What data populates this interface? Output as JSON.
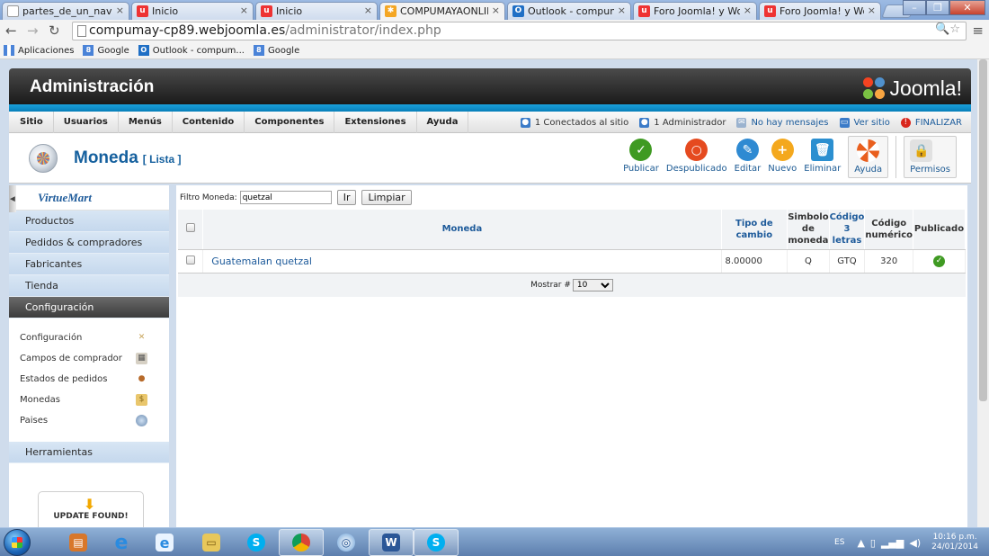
{
  "browser": {
    "tabs": [
      {
        "title": "partes_de_un_navegad",
        "icon": "doc"
      },
      {
        "title": "Inicio",
        "icon": "u"
      },
      {
        "title": "Inicio",
        "icon": "u"
      },
      {
        "title": "COMPUMAYAONLINE",
        "icon": "joomla"
      },
      {
        "title": "Outlook - compumaya",
        "icon": "outlook"
      },
      {
        "title": "Foro Joomla! y WordP",
        "icon": "u"
      },
      {
        "title": "Foro Joomla! y WordP",
        "icon": "u"
      }
    ],
    "url_host": "compumay-cp89.webjoomla.es",
    "url_path": "/administrator/index.php",
    "bookmarks": [
      {
        "label": "Aplicaciones",
        "icon": "apps"
      },
      {
        "label": "Google",
        "icon": "g"
      },
      {
        "label": "Outlook - compum...",
        "icon": "o"
      },
      {
        "label": "Google",
        "icon": "g"
      }
    ]
  },
  "joomla": {
    "admin_title": "Administración",
    "logo_text": "Joomla!",
    "menu": [
      "Sitio",
      "Usuarios",
      "Menús",
      "Contenido",
      "Componentes",
      "Extensiones",
      "Ayuda"
    ],
    "status": {
      "connected": "1 Conectados al sitio",
      "admins": "1 Administrador",
      "messages": "No hay mensajes",
      "view_site": "Ver sitio",
      "logout": "FINALIZAR"
    },
    "page_title": "Moneda",
    "page_subtitle": "[ Lista ]",
    "toolbar": [
      "Publicar",
      "Despublicado",
      "Editar",
      "Nuevo",
      "Eliminar",
      "Ayuda",
      "Permisos"
    ]
  },
  "sidebar": {
    "logo": "VirtueMart",
    "items": [
      "Productos",
      "Pedidos & compradores",
      "Fabricantes",
      "Tienda",
      "Configuración"
    ],
    "subitems": [
      "Configuración",
      "Campos de comprador",
      "Estados de pedidos",
      "Monedas",
      "Paises"
    ],
    "tools": "Herramientas",
    "update": "UPDATE FOUND!"
  },
  "filter": {
    "label": "Filtro Moneda:",
    "value": "quetzal",
    "go": "Ir",
    "clear": "Limpiar"
  },
  "table": {
    "headers": {
      "moneda": "Moneda",
      "rate": "Tipo de cambio",
      "symbol": "Simbolo de moneda",
      "code3": "Código 3 letras",
      "numeric": "Código numérico",
      "published": "Publicado"
    },
    "rows": [
      {
        "name": "Guatemalan quetzal",
        "rate": "8.00000",
        "symbol": "Q",
        "code3": "GTQ",
        "numeric": "320",
        "published": true
      }
    ]
  },
  "pager": {
    "label": "Mostrar #",
    "value": "10"
  },
  "taskbar": {
    "lang": "ES",
    "time": "10:16 p.m.",
    "date": "24/01/2014"
  }
}
